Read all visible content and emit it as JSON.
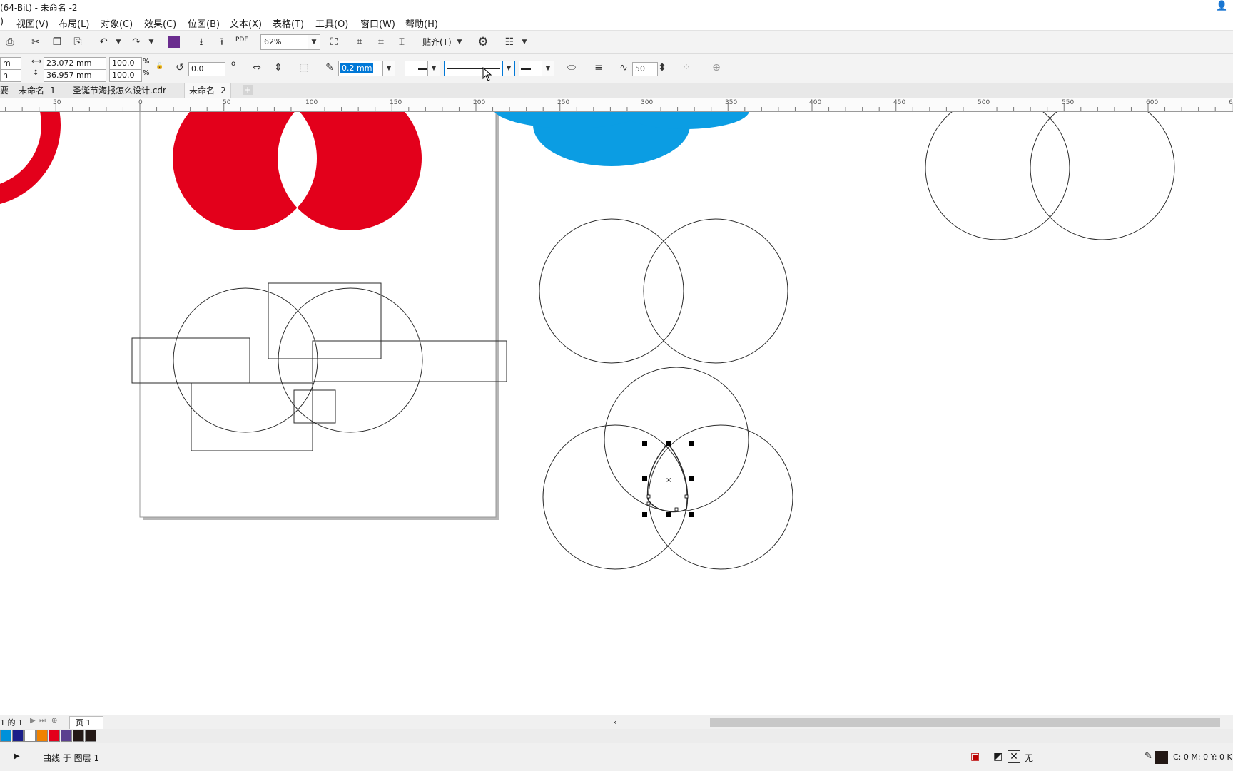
{
  "window": {
    "title": "(64-Bit) - 未命名 -2"
  },
  "menu": [
    {
      "label": ")"
    },
    {
      "label": "视图(V)"
    },
    {
      "label": "布局(L)"
    },
    {
      "label": "对象(C)"
    },
    {
      "label": "效果(C)"
    },
    {
      "label": "位图(B)"
    },
    {
      "label": "文本(X)"
    },
    {
      "label": "表格(T)"
    },
    {
      "label": "工具(O)"
    },
    {
      "label": "窗口(W)"
    },
    {
      "label": "帮助(H)"
    }
  ],
  "toolbar": {
    "zoom": "62%",
    "pdf_label": "PDF",
    "snap_label": "贴齐(T)"
  },
  "propbar": {
    "x_stub": "m",
    "y_stub": "n",
    "width": "23.072 mm",
    "height": "36.957 mm",
    "scale_w": "100.0",
    "scale_h": "100.0",
    "percent": "%",
    "rotation": "0.0",
    "degree": "o",
    "outline_width": "0.2 mm",
    "smoothing": "50"
  },
  "tabs": [
    {
      "label": "要"
    },
    {
      "label": "未命名 -1"
    },
    {
      "label": "圣诞节海报怎么设计.cdr"
    },
    {
      "label": "未命名 -2"
    }
  ],
  "ruler": {
    "labels": [
      "50",
      "0",
      "50",
      "100",
      "150",
      "200",
      "250",
      "300",
      "350",
      "400",
      "450",
      "500",
      "550",
      "600",
      "6"
    ]
  },
  "pagebar": {
    "page_of": "1 的 1",
    "page_tab": "页 1"
  },
  "palette": {
    "colors": [
      "#0091da",
      "#1b1f8a",
      "#ffffff",
      "#f08200",
      "#e3001b",
      "#5b3f8f",
      "#231815",
      "#231815"
    ]
  },
  "status": {
    "selection": "曲线 于 图层 1",
    "fill_label": "无",
    "color_readout": "C: 0 M: 0 Y: 0 K:"
  },
  "colors": {
    "red": "#e3001b",
    "blue": "#0b9de3",
    "selection_blue": "#0078d7"
  }
}
